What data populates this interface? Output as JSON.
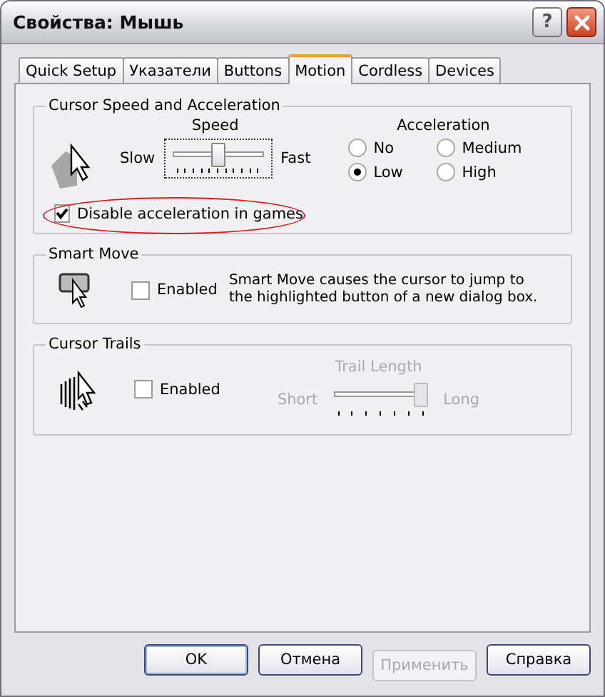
{
  "window": {
    "title": "Свойства: Мышь",
    "help": "?"
  },
  "tabs": [
    {
      "label": "Quick Setup",
      "selected": false
    },
    {
      "label": "Указатели",
      "selected": false
    },
    {
      "label": "Buttons",
      "selected": false
    },
    {
      "label": "Motion",
      "selected": true
    },
    {
      "label": "Cordless",
      "selected": false
    },
    {
      "label": "Devices",
      "selected": false
    }
  ],
  "speed_group": {
    "title": "Cursor Speed and Acceleration",
    "speed_label": "Speed",
    "slow": "Slow",
    "fast": "Fast",
    "level": 0.5,
    "acceleration_label": "Acceleration",
    "options": [
      {
        "label": "No",
        "selected": false
      },
      {
        "label": "Medium",
        "selected": false
      },
      {
        "label": "Low",
        "selected": true
      },
      {
        "label": "High",
        "selected": false
      }
    ],
    "disable_checkbox": {
      "label": "Disable acceleration in games",
      "checked": true,
      "highlighted": true
    }
  },
  "smart_move": {
    "title": "Smart Move",
    "checkbox": {
      "label": "Enabled",
      "checked": false
    },
    "description": "Smart Move causes the cursor to jump to the highlighted button of a new dialog box."
  },
  "cursor_trails": {
    "title": "Cursor Trails",
    "checkbox": {
      "label": "Enabled",
      "checked": false
    },
    "trail_length_label": "Trail Length",
    "short": "Short",
    "long": "Long",
    "level": 1,
    "disabled": true
  },
  "buttons": [
    {
      "label": "OK",
      "disabled": false,
      "default": true
    },
    {
      "label": "Отмена",
      "disabled": false,
      "default": false
    },
    {
      "label": "Применить",
      "disabled": true,
      "default": false
    },
    {
      "label": "Справка",
      "disabled": false,
      "default": false
    }
  ]
}
